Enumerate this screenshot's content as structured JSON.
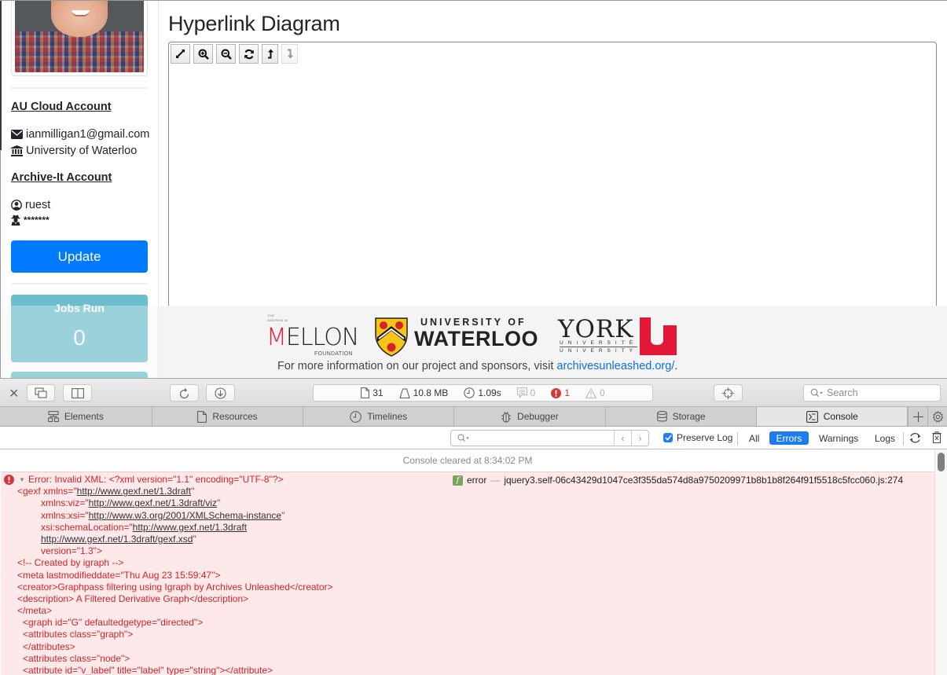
{
  "sidebar": {
    "avatar_alt": "profile photo",
    "cloud_account": {
      "title": "AU Cloud Account",
      "email": "ianmilligan1@gmail.com",
      "institution": "University of Waterloo"
    },
    "archive_it_account": {
      "title": "Archive-It Account",
      "username": "ruest",
      "password": "*******"
    },
    "update_label": "Update",
    "stats": [
      {
        "label": "Jobs Run",
        "value": "0"
      },
      {
        "label": "",
        "value": ""
      }
    ]
  },
  "main": {
    "title": "Hyperlink Diagram",
    "toolbar": [
      {
        "name": "fullscreen",
        "icon": "expand-icon",
        "enabled": true
      },
      {
        "name": "zoom-in",
        "icon": "zoom-in-icon",
        "enabled": true
      },
      {
        "name": "zoom-out",
        "icon": "zoom-out-icon",
        "enabled": true
      },
      {
        "name": "refresh",
        "icon": "refresh-icon",
        "enabled": true
      },
      {
        "name": "raise",
        "icon": "arrow-up-icon",
        "enabled": true
      },
      {
        "name": "lower",
        "icon": "arrow-down-icon",
        "enabled": false
      }
    ]
  },
  "footer": {
    "mellon": {
      "the": "THE",
      "andrew": "ANDREW W.",
      "name": "MELLON",
      "foundation": "FOUNDATION"
    },
    "waterloo": {
      "top": "UNIVERSITY OF",
      "bottom": "WATERLOO"
    },
    "york": {
      "word": "YORK",
      "line1": "UNIVERSITÉ",
      "line2": "UNIVERSITY"
    },
    "text_prefix": "For more information on our project and sponsors, visit ",
    "link_text": "archivesunleashed.org/",
    "text_suffix": ".",
    "accent_color": "#e41e3f"
  },
  "inspector": {
    "activity": {
      "resources": "31",
      "size": "10.8 MB",
      "load_time": "1.09s",
      "logs": "0",
      "errors": "1",
      "warnings": "0"
    },
    "search_placeholder": "Search",
    "tabs": [
      {
        "label": "Elements",
        "icon": "elements-icon"
      },
      {
        "label": "Resources",
        "icon": "document-icon"
      },
      {
        "label": "Timelines",
        "icon": "clock-icon"
      },
      {
        "label": "Debugger",
        "icon": "bug-icon"
      },
      {
        "label": "Storage",
        "icon": "database-icon"
      },
      {
        "label": "Console",
        "icon": "console-icon",
        "active": true
      }
    ],
    "console": {
      "filter_placeholder": "",
      "preserve_log_label": "Preserve Log",
      "preserve_log_checked": true,
      "levels": [
        "All",
        "Errors",
        "Warnings",
        "Logs"
      ],
      "active_level": "Errors",
      "cleared_text": "Console cleared at 8:34:02 PM",
      "error": {
        "lines": [
          "Error: Invalid XML: <?xml version=\"1.1\" encoding=\"UTF-8\"?>",
          "<gexf xmlns=\"http://www.gexf.net/1.3draft\"",
          "        xmlns:viz=\"http://www.gexf.net/1.3draft/viz\"",
          "        xmlns:xsi=\"http://www.w3.org/2001/XMLSchema-instance\"",
          "        xsi:schemaLocation=\"http://www.gexf.net/1.3draft",
          "        http://www.gexf.net/1.3draft/gexf.xsd\"",
          "        version=\"1.3\">",
          "<!-- Created by igraph -->",
          "<meta lastmodifieddate=\"Thu Aug 23 15:59:47\">",
          "<creator>Graphpass filtering using Igraph by Archives Unleashed</creator>",
          "<description> A Filtered Derivative Graph</description>",
          "</meta>",
          "  <graph id=\"G\" defaultedgetype=\"directed\">",
          "  <attributes class=\"graph\">",
          "  </attributes>",
          "  <attributes class=\"node\">",
          "  <attribute id=\"v_label\" title=\"label\" type=\"string\"></attribute>"
        ],
        "function_name": "error",
        "source": "jquery3.self-06c43429d1047ce3f355da574d8a9750209971b8b1b8f264f91f5518c5fcc060.js:274"
      }
    }
  }
}
